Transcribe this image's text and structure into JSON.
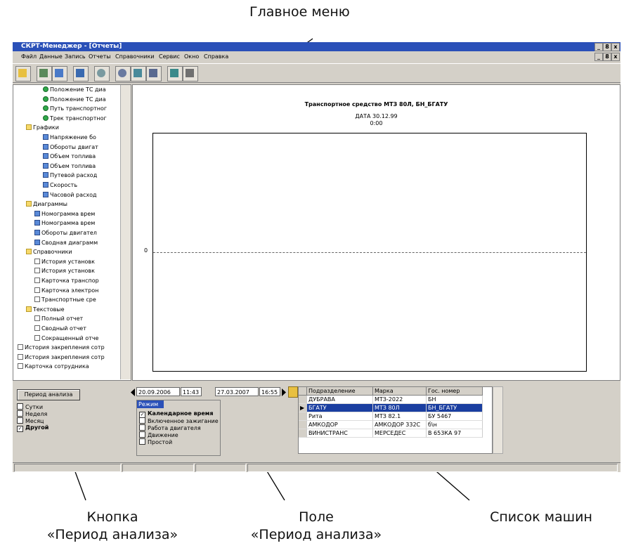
{
  "callouts": {
    "main_menu": "Главное меню",
    "btn_line1": "Кнопка",
    "btn_line2": "«Период анализа»",
    "field_line1": "Поле",
    "field_line2": "«Период анализа»",
    "list": "Список машин"
  },
  "window": {
    "title": "СКРТ-Менеджер - [Отчеты]",
    "buttons": [
      "_",
      "8",
      "x"
    ]
  },
  "menu": [
    "Файл",
    "Данные",
    "Запись",
    "Отчеты",
    "Справочники",
    "Сервис",
    "Окно",
    "Справка"
  ],
  "tree": [
    {
      "label": "Положение ТС диа",
      "kind": "radio",
      "level": 3
    },
    {
      "label": "Положение ТС диа",
      "kind": "radio",
      "level": 3
    },
    {
      "label": "Путь транспортног",
      "kind": "radio",
      "level": 3
    },
    {
      "label": "Трек транспортног",
      "kind": "radio",
      "level": 3
    },
    {
      "label": "Графики",
      "kind": "folder",
      "level": 1
    },
    {
      "label": "Напряжение бо",
      "kind": "check",
      "level": 3
    },
    {
      "label": "Обороты двигат",
      "kind": "check",
      "level": 3
    },
    {
      "label": "Объем топлива",
      "kind": "check",
      "level": 3
    },
    {
      "label": "Объем топлива",
      "kind": "check",
      "level": 3
    },
    {
      "label": "Путевой расход",
      "kind": "check",
      "level": 3
    },
    {
      "label": "Скорость",
      "kind": "check",
      "level": 3
    },
    {
      "label": "Часовой расход",
      "kind": "check",
      "level": 3
    },
    {
      "label": "Диаграммы",
      "kind": "folder",
      "level": 1
    },
    {
      "label": "Номограмма врем",
      "kind": "check",
      "level": 2
    },
    {
      "label": "Номограмма врем",
      "kind": "check",
      "level": 2
    },
    {
      "label": "Обороты двигател",
      "kind": "check",
      "level": 2
    },
    {
      "label": "Сводная диаграмм",
      "kind": "check",
      "level": 2
    },
    {
      "label": "Справочники",
      "kind": "folder",
      "level": 1
    },
    {
      "label": "История установк",
      "kind": "doc",
      "level": 2
    },
    {
      "label": "История установк",
      "kind": "doc",
      "level": 2
    },
    {
      "label": "Карточка транспор",
      "kind": "doc",
      "level": 2
    },
    {
      "label": "Карточка электрон",
      "kind": "doc",
      "level": 2
    },
    {
      "label": "Транспортные сре",
      "kind": "doc",
      "level": 2
    },
    {
      "label": "Текстовые",
      "kind": "folder",
      "level": 1
    },
    {
      "label": "Полный отчет",
      "kind": "doc",
      "level": 2
    },
    {
      "label": "Сводный отчет",
      "kind": "doc",
      "level": 2
    },
    {
      "label": "Сокращенный отче",
      "kind": "doc",
      "level": 2
    },
    {
      "label": "История закрепления сотр",
      "kind": "doc",
      "level": 0
    },
    {
      "label": "История закрепления сотр",
      "kind": "doc",
      "level": 0
    },
    {
      "label": "Карточка сотрудника",
      "kind": "doc",
      "level": 0
    }
  ],
  "report": {
    "title": "Транспортное средство МТЗ 80Л, БН_БГАТУ",
    "date_line": "ДАТА 30.12.99",
    "time_line": "0:00",
    "zero_label": "0"
  },
  "period": {
    "button_label": "Период анализа",
    "options": [
      {
        "label": "Сутки",
        "checked": false
      },
      {
        "label": "Неделя",
        "checked": false
      },
      {
        "label": "Месяц",
        "checked": false
      },
      {
        "label": "Другой",
        "checked": true
      }
    ]
  },
  "range": {
    "start_date": "20.09.2006",
    "start_time": "11:43",
    "end_date": "27.03.2007",
    "end_time": "16:55"
  },
  "mode": {
    "header": "Режим",
    "options": [
      {
        "label": "Календарное время",
        "checked": true
      },
      {
        "label": "Включенное зажигание",
        "checked": false
      },
      {
        "label": "Работа двигателя",
        "checked": false
      },
      {
        "label": "Движение",
        "checked": false
      },
      {
        "label": "Простой",
        "checked": false
      }
    ]
  },
  "vehicles": {
    "columns": [
      "Подразделение",
      "Марка",
      "Гос. номер"
    ],
    "rows": [
      [
        "ДУБРАВА",
        "МТЗ-2022",
        "БН"
      ],
      [
        "БГАТУ",
        "МТЗ 80Л",
        "БН_БГАТУ"
      ],
      [
        "Рита",
        "МТЗ 82.1",
        "БУ 5467"
      ],
      [
        "АМКОДОР",
        "АМКОДОР 332С",
        "б\\н"
      ],
      [
        "ВИНИСТРАНС",
        "МЕРСЕДЕС",
        "В 653КА 97"
      ]
    ],
    "selected_index": 1
  }
}
